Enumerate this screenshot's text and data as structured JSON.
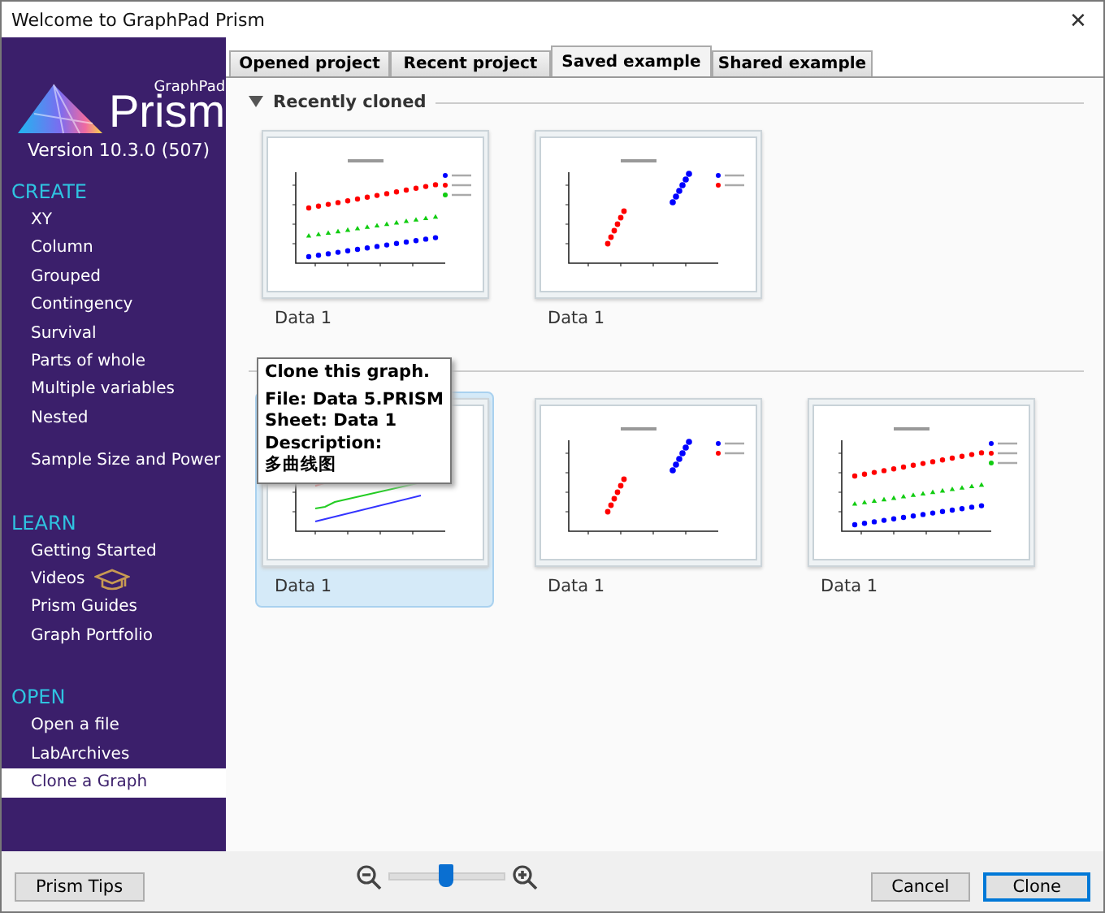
{
  "window": {
    "title": "Welcome to GraphPad Prism",
    "close": "✕"
  },
  "logo": {
    "brand": "GraphPad",
    "product": "Prism",
    "version": "Version 10.3.0 (507)"
  },
  "sidebar": {
    "groups": [
      {
        "heading": "CREATE",
        "blocks": [
          [
            {
              "label": "XY",
              "selected": false,
              "has_icon": false
            },
            {
              "label": "Column",
              "selected": false,
              "has_icon": false
            },
            {
              "label": "Grouped",
              "selected": false,
              "has_icon": false
            },
            {
              "label": "Contingency",
              "selected": false,
              "has_icon": false
            },
            {
              "label": "Survival",
              "selected": false,
              "has_icon": false
            },
            {
              "label": "Parts of whole",
              "selected": false,
              "has_icon": false
            },
            {
              "label": "Multiple variables",
              "selected": false,
              "has_icon": false
            },
            {
              "label": "Nested",
              "selected": false,
              "has_icon": false
            }
          ],
          [
            {
              "label": "Sample Size and Power",
              "selected": false,
              "has_icon": false
            }
          ]
        ]
      },
      {
        "heading": "LEARN",
        "blocks": [
          [
            {
              "label": "Getting Started",
              "selected": false,
              "has_icon": false
            },
            {
              "label": "Videos",
              "selected": false,
              "has_icon": true
            },
            {
              "label": "Prism Guides",
              "selected": false,
              "has_icon": false
            },
            {
              "label": "Graph Portfolio",
              "selected": false,
              "has_icon": false
            }
          ]
        ]
      },
      {
        "heading": "OPEN",
        "blocks": [
          [
            {
              "label": "Open a file",
              "selected": false,
              "has_icon": false
            },
            {
              "label": "LabArchives",
              "selected": false,
              "has_icon": false
            },
            {
              "label": "Clone a Graph",
              "selected": true,
              "has_icon": false
            }
          ]
        ]
      }
    ]
  },
  "tabs": [
    {
      "label": "Opened project",
      "selected": false
    },
    {
      "label": "Recent project",
      "selected": false
    },
    {
      "label": "Saved example",
      "selected": true
    },
    {
      "label": "Shared example",
      "selected": false
    }
  ],
  "sections": [
    {
      "title": "Recently cloned",
      "expanded": true,
      "items": [
        {
          "label": "Data 1",
          "kind": "scatter-trend",
          "selected": false
        },
        {
          "label": "Data 1",
          "kind": "scatter-cluster",
          "selected": false
        }
      ]
    },
    {
      "items": [
        {
          "label": "Data 1",
          "kind": "line",
          "selected": true
        },
        {
          "label": "Data 1",
          "kind": "scatter-cluster",
          "selected": false
        },
        {
          "label": "Data 1",
          "kind": "scatter-trend",
          "selected": false
        }
      ]
    }
  ],
  "tooltip": {
    "lines": [
      "Clone this graph.",
      "File: Data 5.PRISM",
      "Sheet: Data 1",
      "Description:",
      "多曲线图"
    ]
  },
  "footer": {
    "tips_button": "Prism Tips",
    "zoom": {
      "level": 0.5
    },
    "buttons": [
      {
        "label": "Cancel",
        "primary": false
      },
      {
        "label": "Clone",
        "primary": true
      }
    ]
  }
}
